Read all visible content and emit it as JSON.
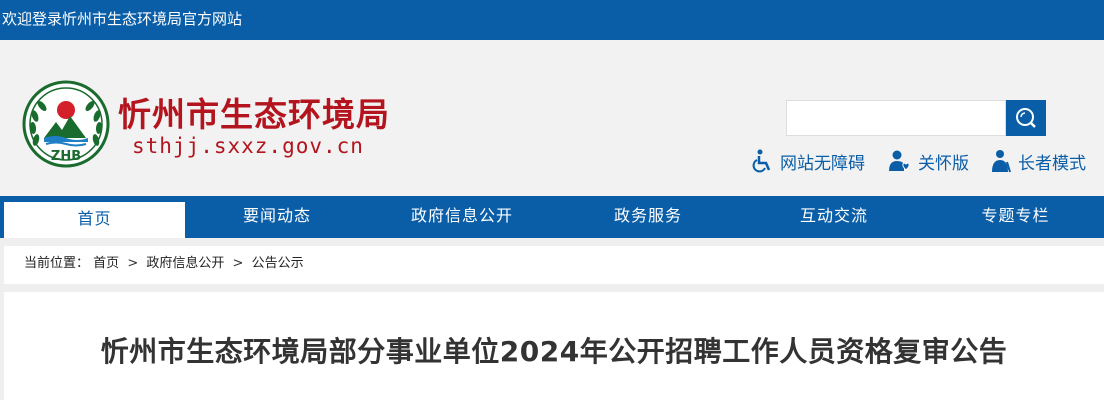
{
  "topbar": {
    "welcome": "欢迎登录忻州市生态环境局官方网站"
  },
  "header": {
    "logo_text": "ZHB",
    "site_title": "忻州市生态环境局",
    "site_url": "sthjj.sxxz.gov.cn",
    "search": {
      "value": "",
      "placeholder": ""
    },
    "tools": [
      {
        "label": "网站无障碍",
        "icon": "wheelchair-icon"
      },
      {
        "label": "关怀版",
        "icon": "care-icon"
      },
      {
        "label": "长者模式",
        "icon": "elder-icon"
      }
    ]
  },
  "nav": {
    "items": [
      {
        "label": "首页",
        "active": true
      },
      {
        "label": "要闻动态"
      },
      {
        "label": "政府信息公开"
      },
      {
        "label": "政务服务"
      },
      {
        "label": "互动交流"
      },
      {
        "label": "专题专栏"
      }
    ]
  },
  "breadcrumb": {
    "prefix": "当前位置：",
    "items": [
      "首页",
      "政府信息公开",
      "公告公示"
    ],
    "separator": ">"
  },
  "article": {
    "title": "忻州市生态环境局部分事业单位2024年公开招聘工作人员资格复审公告"
  },
  "colors": {
    "brand_blue": "#0a5ea8",
    "title_red": "#b3141d"
  }
}
